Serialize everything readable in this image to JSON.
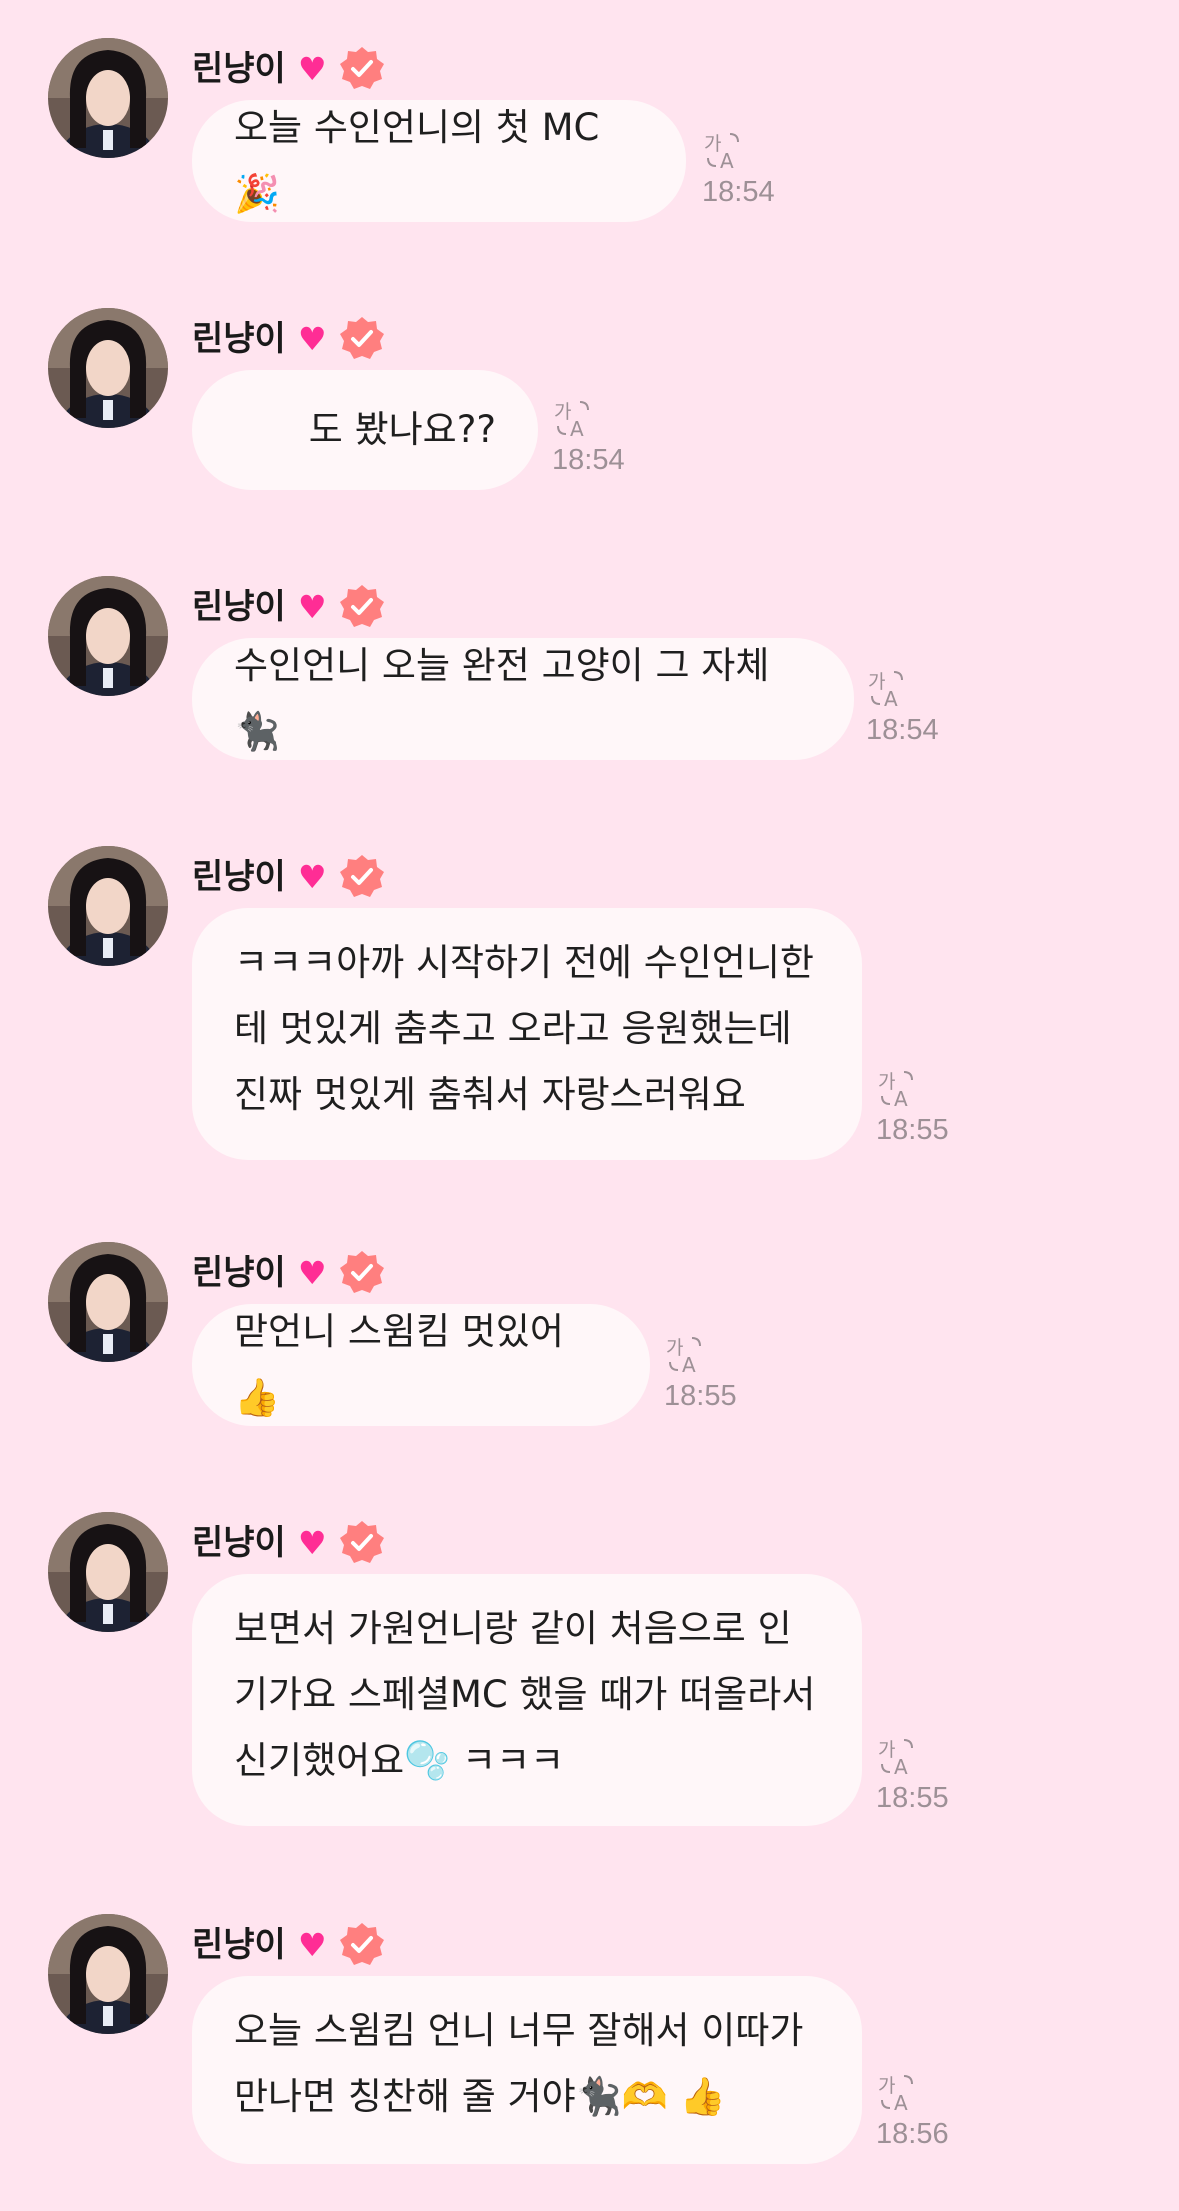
{
  "sender": {
    "name": "린냥이",
    "heart": "♥",
    "verified": true
  },
  "colors": {
    "background": "#ffe4ef",
    "bubble": "#fff7f9",
    "heart": "#ff2d95",
    "badge": "#ff7f7f",
    "meta": "#9d9096"
  },
  "translate_icon": "translate-icon",
  "messages": [
    {
      "text": "오늘 수인언니의 첫 MC🎉",
      "time": "18:54"
    },
    {
      "text": "도 봤나요??",
      "time": "18:54"
    },
    {
      "text": "수인언니 오늘 완전 고양이 그 자체🐈‍⬛",
      "time": "18:54"
    },
    {
      "text": "ㅋㅋㅋ아까 시작하기 전에 수인언니한\n테 멋있게 춤추고 오라고 응원했는데\n진짜 멋있게 춤춰서 자랑스러워요",
      "time": "18:55"
    },
    {
      "text": "맏언니 스윔킴 멋있어👍",
      "time": "18:55"
    },
    {
      "text": "보면서 가원언니랑 같이 처음으로 인\n기가요 스페셜MC 했을 때가 떠올라서\n신기했어요🫧 ㅋㅋㅋ",
      "time": "18:55"
    },
    {
      "text": "오늘 스윔킴 언니 너무 잘해서 이따가\n만나면 칭찬해 줄 거야🐈‍⬛🫶 👍",
      "time": "18:56"
    }
  ]
}
